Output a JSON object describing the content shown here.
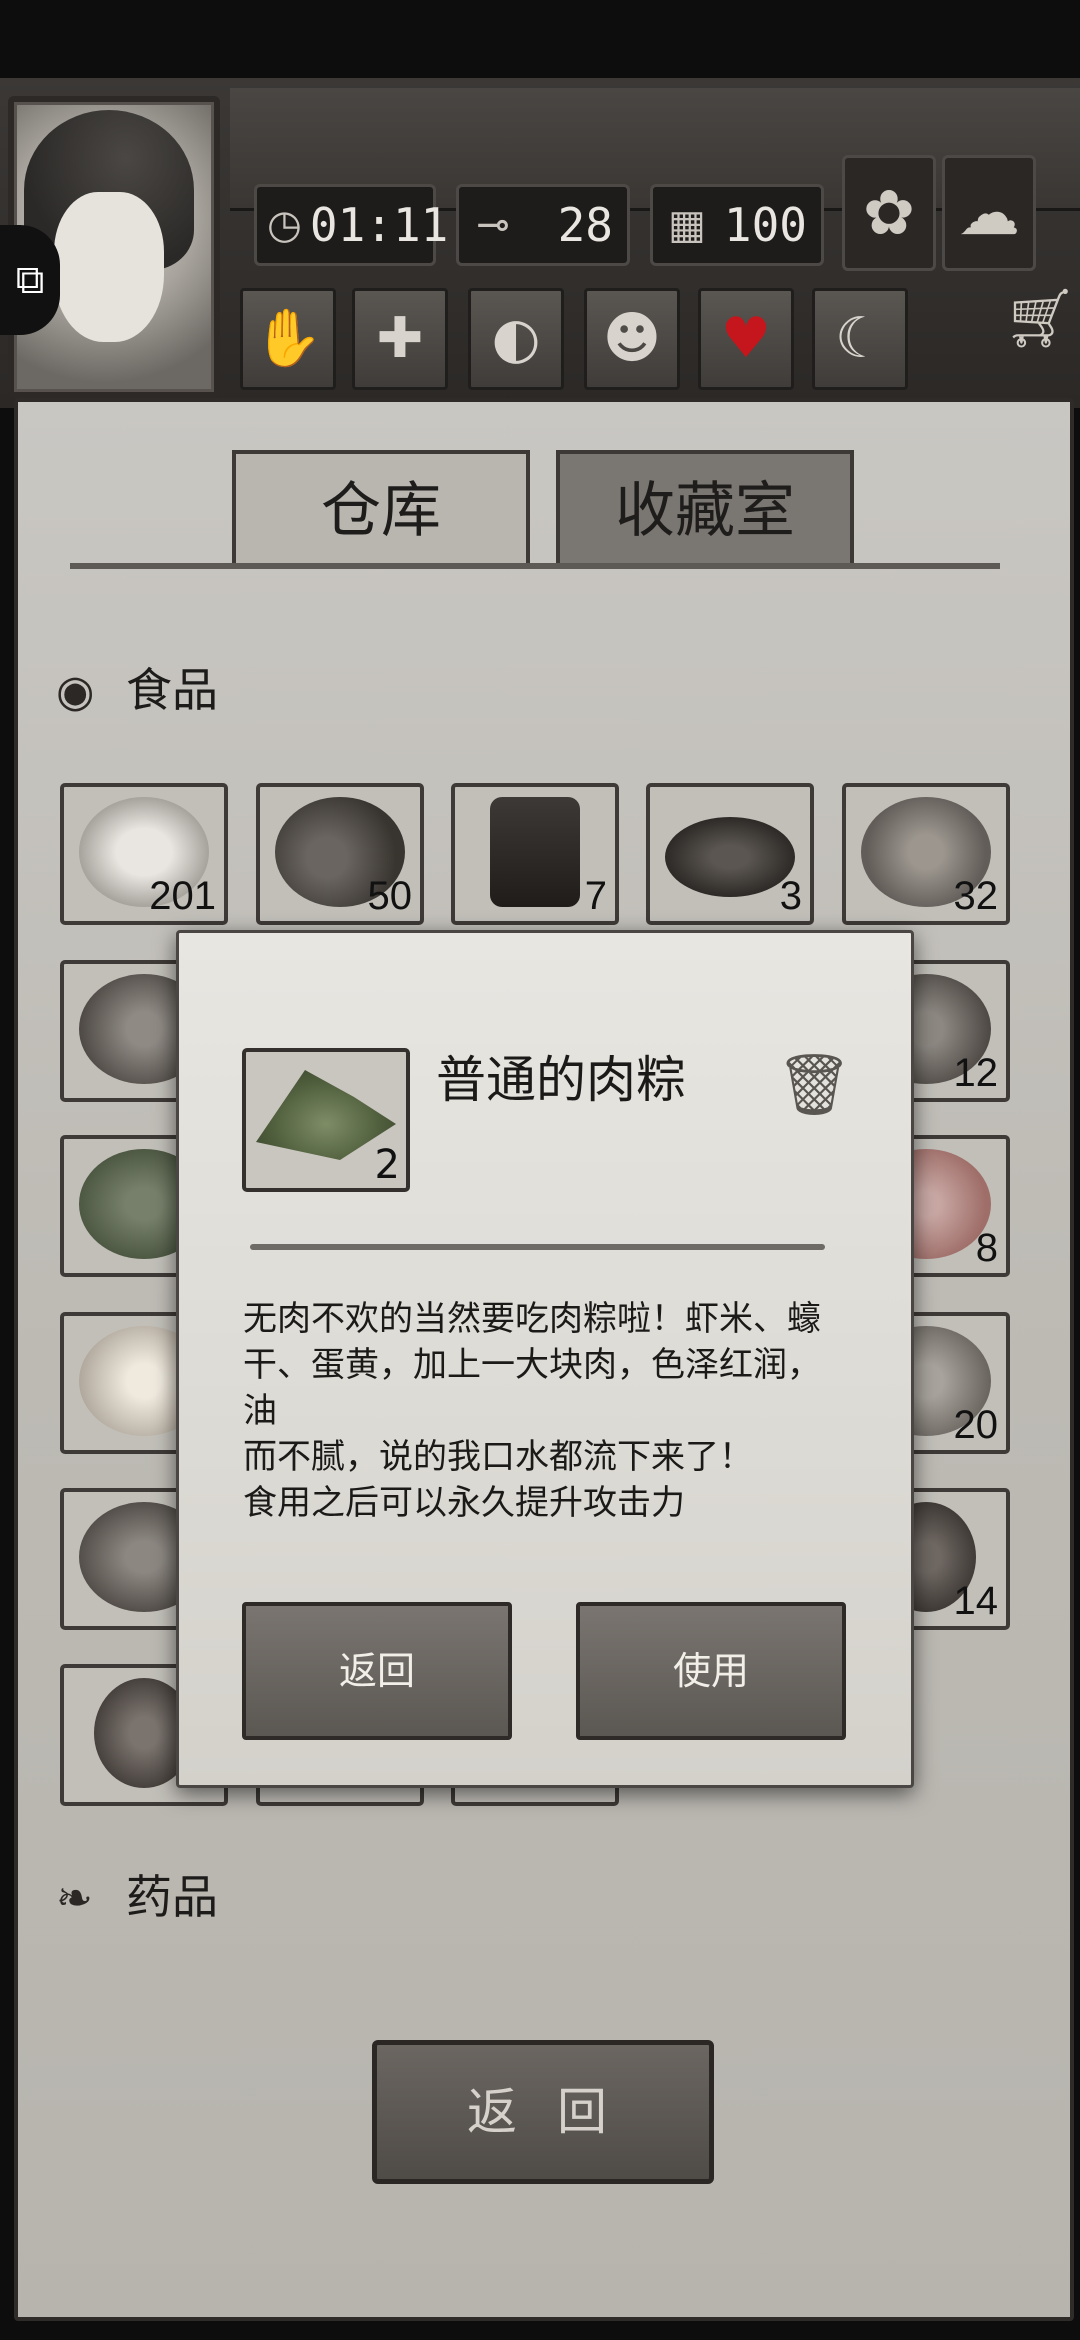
{
  "hud": {
    "time": "01:11",
    "temperature": "28",
    "days": "100",
    "icons": {
      "time": "clock-icon",
      "temperature": "thermometer-icon",
      "days": "calendar-icon",
      "weather_day": "sunflower-icon",
      "weather": "cloud-icon",
      "puzzle": "puzzle-icon",
      "cart": "shopping-cart-icon"
    },
    "tools": [
      "hand-icon",
      "medical-cross-icon",
      "stomach-icon",
      "brain-icon",
      "heart-icon",
      "moon-icon"
    ]
  },
  "tabs": [
    {
      "label": "仓库"
    },
    {
      "label": "收藏室"
    }
  ],
  "sections": {
    "food": {
      "label": "食品",
      "icon": "meat-icon"
    },
    "medicine": {
      "label": "药品",
      "icon": "leaf-icon"
    }
  },
  "inventory": {
    "row1": [
      {
        "count": "201",
        "item": "ham"
      },
      {
        "count": "50",
        "item": "coconut-and-beet"
      },
      {
        "count": "7",
        "item": "canned-tea"
      },
      {
        "count": "3",
        "item": "grilled-steak"
      },
      {
        "count": "32",
        "item": "honeycomb"
      }
    ],
    "right_counts": [
      "12",
      "8",
      "20",
      "14"
    ]
  },
  "dialog": {
    "item_name": "普通的肉粽",
    "item_count": "2",
    "description": "无肉不欢的当然要吃肉粽啦！虾米、蠔\n干、蛋黄，加上一大块肉，色泽红润，油\n而不腻，说的我口水都流下来了！\n食用之后可以永久提升攻击力",
    "back_label": "返回",
    "use_label": "使用",
    "trash_icon": "trash-icon"
  },
  "footer": {
    "back_label": "返 回"
  },
  "colors": {
    "panel": "#c4c1bb",
    "button": "#5b5752",
    "heart": "#c4161c"
  }
}
